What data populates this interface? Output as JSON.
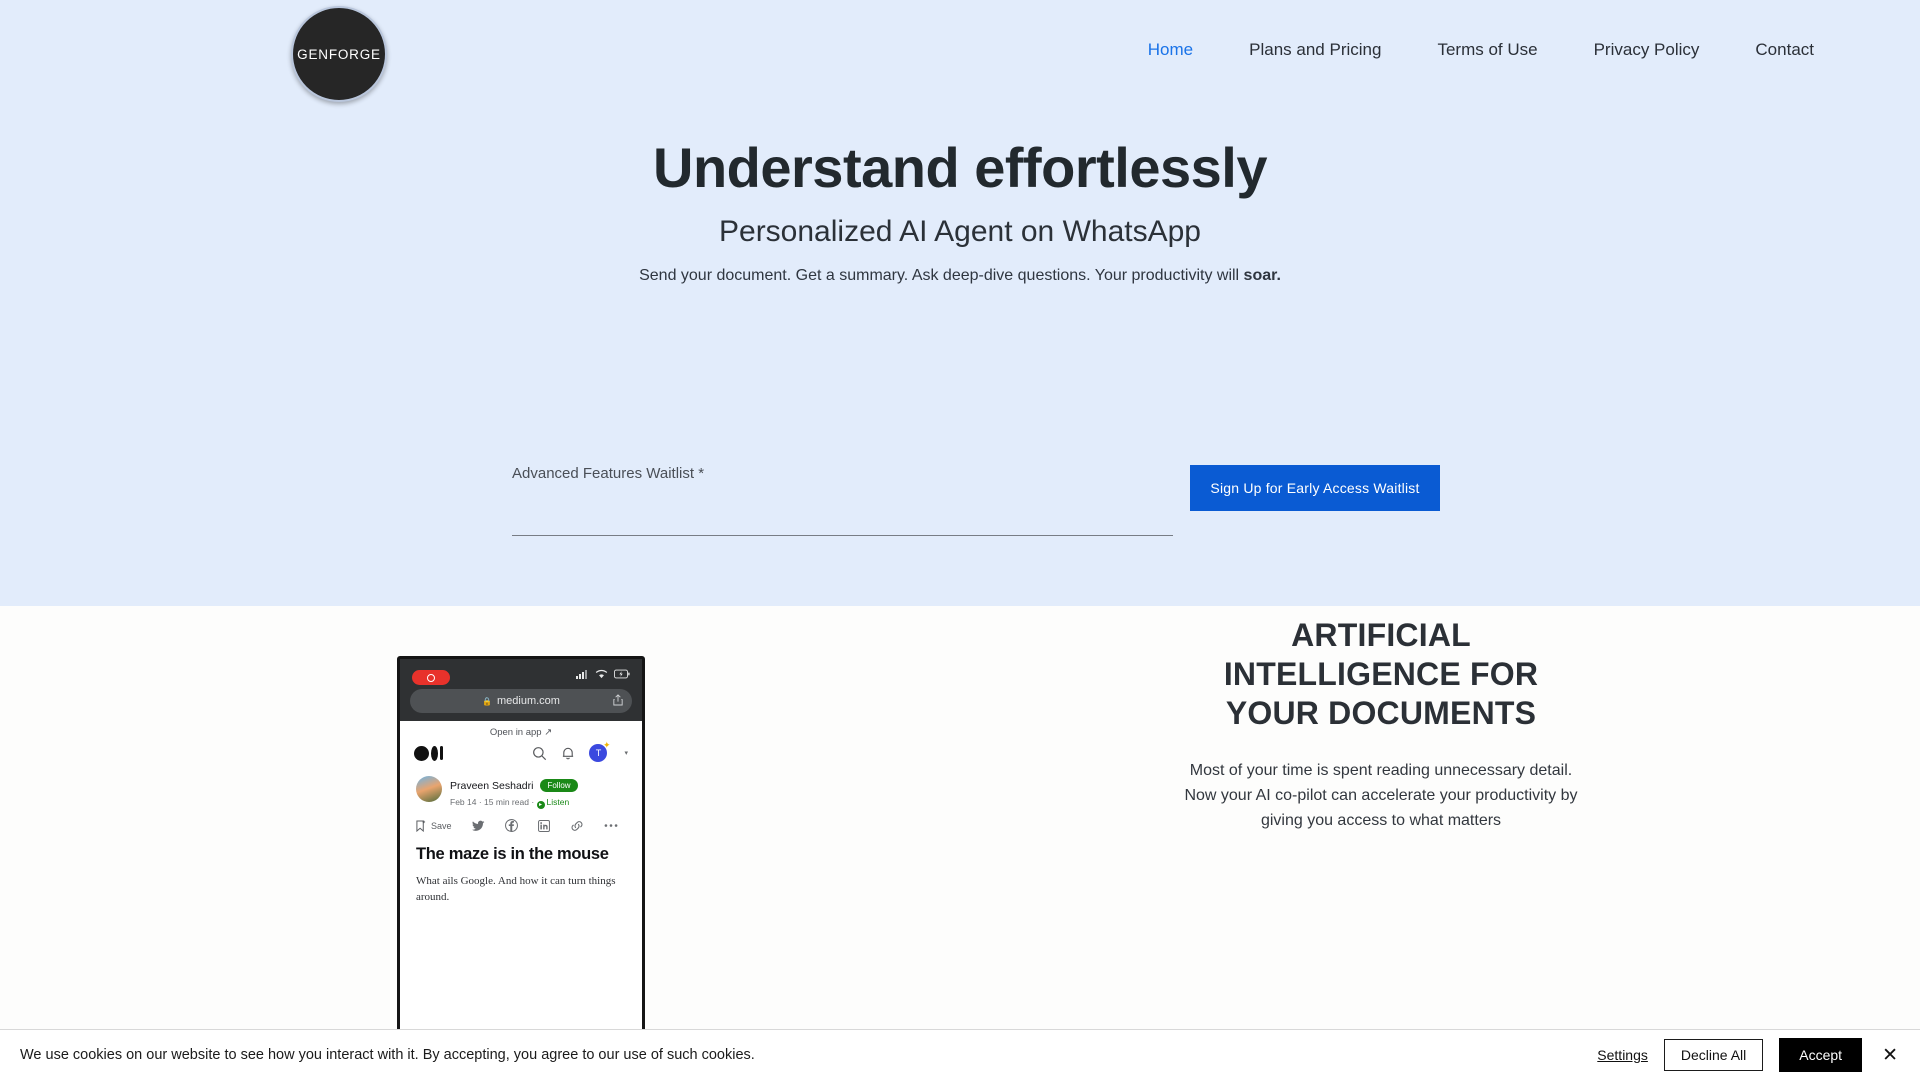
{
  "brand": {
    "logo_text": "GENFORGE"
  },
  "nav": {
    "items": [
      {
        "label": "Home",
        "active": true
      },
      {
        "label": "Plans and Pricing",
        "active": false
      },
      {
        "label": "Terms of Use",
        "active": false
      },
      {
        "label": "Privacy Policy",
        "active": false
      },
      {
        "label": "Contact",
        "active": false
      }
    ]
  },
  "hero": {
    "title": "Understand effortlessly",
    "subtitle": "Personalized AI Agent on WhatsApp",
    "desc_plain": "Send your document. Get a summary. Ask deep-dive questions. Your productivity will ",
    "desc_bold": "soar.",
    "form": {
      "label": "Advanced Features Waitlist *",
      "input_value": "",
      "input_placeholder": "",
      "cta_label": "Sign Up for Early Access Waitlist",
      "cta_color": "#0a5bd3"
    }
  },
  "phone": {
    "browser": {
      "url": "medium.com",
      "lock_icon": "lock-icon",
      "share_icon": "share-icon",
      "record_icon": "record-indicator-icon",
      "signal_icon": "cellular-signal-icon",
      "wifi_icon": "wifi-icon",
      "battery_icon": "battery-charging-icon"
    },
    "open_in_app": "Open in app  ↗",
    "actions": {
      "search_icon": "search-icon",
      "bell_icon": "notification-bell-icon",
      "avatar_initial": "T"
    },
    "article": {
      "author": "Praveen Seshadri",
      "follow_label": "Follow",
      "date": "Feb 14",
      "read_time": "15 min read",
      "listen_label": "Listen",
      "save_label": "Save",
      "title": "The maze is in the mouse",
      "subtitle": "What ails Google. And how it can turn things around."
    }
  },
  "feature": {
    "title": "ARTIFICIAL INTELLIGENCE FOR YOUR DOCUMENTS",
    "body": "Most of your time is spent reading unnecessary detail. Now your AI co-pilot can accelerate your productivity by giving you access to what matters"
  },
  "cookie_banner": {
    "text": "We use cookies on our website to see how you interact with it. By accepting, you agree to our use of such cookies.",
    "settings_label": "Settings",
    "decline_label": "Decline All",
    "accept_label": "Accept",
    "close_icon": "close-icon"
  }
}
